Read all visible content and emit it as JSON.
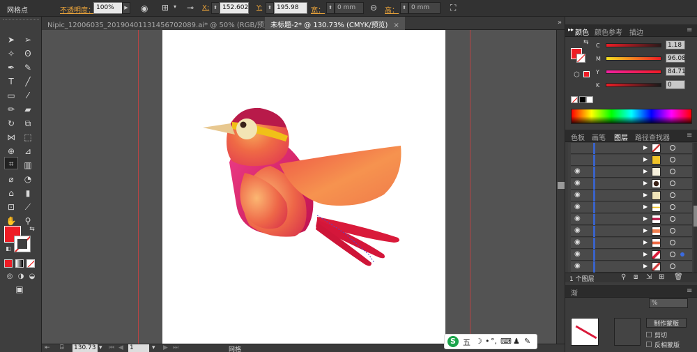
{
  "topbar": {
    "mode": "网格点",
    "opacity_label": "不透明度：",
    "opacity_value": "100%",
    "x_label": "X:",
    "x_value": "152.602",
    "y_label": "Y:",
    "y_value": "195.98",
    "width_label": "宽：",
    "width_value": "0 mm",
    "height_label": "高：",
    "height_value": "0 mm"
  },
  "tabs": [
    {
      "label": "Nipic_12006035_20190401131456702089.ai* @ 50% (RGB/预览)",
      "close": "×"
    },
    {
      "label": "未标题-2* @ 130.73% (CMYK/预览)",
      "close": "×"
    }
  ],
  "status": {
    "zoom": "130.73",
    "page": "1",
    "tool_name": "网格"
  },
  "ime": {
    "logo": "S",
    "mode": "五",
    "items": [
      "☽",
      "•",
      "°,",
      "⌨",
      "♟",
      "✎"
    ]
  },
  "color_panel": {
    "tabs": [
      "颜色",
      "颜色参考",
      "描边"
    ],
    "channels": [
      {
        "name": "C",
        "value": "1.18"
      },
      {
        "name": "M",
        "value": "96.08"
      },
      {
        "name": "Y",
        "value": "84.71"
      },
      {
        "name": "K",
        "value": "0"
      }
    ],
    "fill_color": "#ee1c25"
  },
  "layers_panel": {
    "tabs": [
      "色板",
      "画笔",
      "图层",
      "路径查找器"
    ],
    "footer_label": "1 个图层"
  },
  "bottom_panel": {
    "tab_partial": "渐",
    "mask_button": "制作蒙版",
    "checkbox1": "剪切",
    "checkbox2": "反相蒙版",
    "percent": "%"
  }
}
